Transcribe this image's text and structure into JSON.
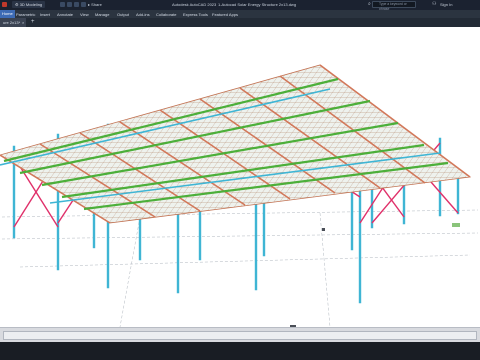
{
  "titlebar": {
    "workspace": "3D Modeling",
    "share": "Share",
    "app_title": "Autodesk AutoCAD 2023",
    "file_title": "1-Autocad Solar Energy Structure 2x13.dwg",
    "search_placeholder": "Type a keyword or phrase",
    "sign_in": "Sign In"
  },
  "ribbon": {
    "tabs": [
      "Home",
      "Parametric",
      "Insert",
      "Annotate",
      "View",
      "Manage",
      "Output",
      "Add-ins",
      "Collaborate",
      "Express Tools",
      "Featured Apps"
    ],
    "active_index": 0
  },
  "document_tab": {
    "label": "ure 2x13*",
    "close": "×",
    "new": "+"
  },
  "colors": {
    "panel_top": "#e5ece7",
    "panel_grid": "#b98f70",
    "purlin": "#4caf3a",
    "rafter": "#d2785a",
    "column": "#3fb5d4",
    "brace": "#e0306a"
  },
  "status": {
    "command_line": ""
  }
}
